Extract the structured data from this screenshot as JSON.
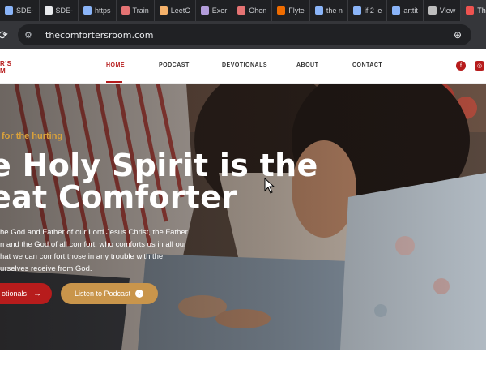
{
  "browser": {
    "tabs": [
      {
        "label": "SDE-",
        "color": "#8ab4f8"
      },
      {
        "label": "SDE-",
        "color": "#e8eaed"
      },
      {
        "label": "https",
        "color": "#8ab4f8"
      },
      {
        "label": "Train",
        "color": "#e57373"
      },
      {
        "label": "LeetC",
        "color": "#f6b26b"
      },
      {
        "label": "Exer",
        "color": "#b39ddb"
      },
      {
        "label": "Ohen",
        "color": "#e57373"
      },
      {
        "label": "Flyte",
        "color": "#ef6c00"
      },
      {
        "label": "the n",
        "color": "#8ab4f8"
      },
      {
        "label": "if 2 le",
        "color": "#8ab4f8"
      },
      {
        "label": "arttit",
        "color": "#8ab4f8"
      },
      {
        "label": "View",
        "color": "#bdbdbd"
      },
      {
        "label": "Th",
        "color": "#ef5350"
      }
    ],
    "url": "thecomfortersroom.com",
    "icons": {
      "reload": "reload-icon",
      "zoom": "zoom-icon",
      "star": "bookmark-star-icon",
      "settings": "site-settings-icon"
    }
  },
  "site": {
    "logo_line1": "R'S",
    "logo_line2": "M",
    "nav": [
      "HOME",
      "PODCAST",
      "DEVOTIONALS",
      "ABOUT",
      "CONTACT"
    ],
    "social": [
      "facebook",
      "instagram"
    ]
  },
  "hero": {
    "kicker": "for the hurting",
    "headline_line1": "e Holy Spirit is the",
    "headline_line2": "eat Comforter",
    "body": "he God and Father of our Lord Jesus Christ, the Father\nn and the God of all comfort, who comforts us in all our\nhat we can comfort those in any trouble with the\nurselves receive from God.",
    "btn_primary": "otionals",
    "btn_secondary": "Listen to Podcast"
  },
  "colors": {
    "brand_red": "#b71c1c",
    "accent_gold": "#c9954b",
    "kicker": "#d9a13b"
  }
}
